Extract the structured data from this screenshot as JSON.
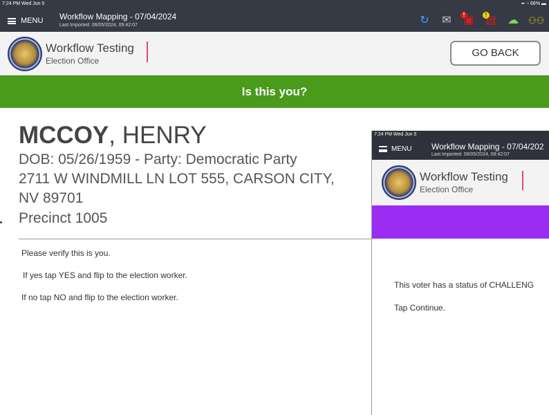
{
  "status": {
    "time_date": "7:24 PM  Wed Jun 5",
    "battery": "66%"
  },
  "topbar": {
    "menu_label": "MENU",
    "workflow_title": "Workflow Mapping - 07/04/2024",
    "last_imported": "Last Imported: 06/05/2024, 09:42:07"
  },
  "icons": {
    "history": "history-icon",
    "mail": "mail-icon",
    "alert_red": "red-alert-icon",
    "alert_yellow": "yellow-alert-icon",
    "cloud": "cloud-upload-icon",
    "users": "users-icon",
    "colors": {
      "history": "#3aa0ff",
      "red": "#e01919",
      "yellow": "#f2d200",
      "green": "#7ed957",
      "users": "#e6c200"
    }
  },
  "header": {
    "org_name": "Workflow Testing",
    "org_sub": "Election Office",
    "go_back": "GO BACK"
  },
  "banner": {
    "text": "Is this you?",
    "color": "#4a9a1c"
  },
  "voter": {
    "last_name": "MCCOY",
    "first_name": ", HENRY",
    "dob_party": "DOB: 05/26/1959 - Party: Democratic Party",
    "address_1": "2711 W WINDMILL LN LOT 555, CARSON CITY,",
    "address_2": "NV 89701",
    "precinct": "Precinct 1005"
  },
  "instructions": {
    "line1": "Please verify this is you.",
    "line2": "If yes tap YES and flip to the election worker.",
    "line3": "If no tap NO and flip to the election worker."
  },
  "overlay": {
    "status_time": "7:24 PM  Wed Jun 5",
    "menu_label": "MENU",
    "workflow_title": "Workflow Mapping - 07/04/202",
    "last_imported": "Last Imported: 06/05/2024, 09:42:07",
    "org_name": "Workflow Testing",
    "org_sub": "Election Office",
    "purple_color": "#9b2df2",
    "message1": "This voter has a status of CHALLENG",
    "message2": "Tap Continue."
  }
}
